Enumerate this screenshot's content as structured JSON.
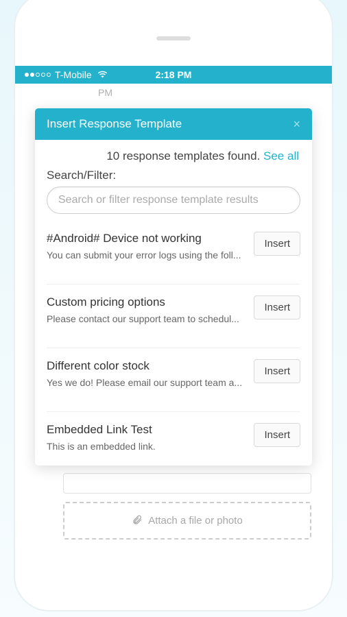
{
  "status_bar": {
    "carrier": "T-Mobile",
    "time": "2:18 PM"
  },
  "background": {
    "pm_text": "PM",
    "attach_label": "Attach a file or photo"
  },
  "modal": {
    "title": "Insert Response Template",
    "close": "×",
    "found_text": "10 response templates found. ",
    "see_all": "See all",
    "filter_label": "Search/Filter:",
    "search_placeholder": "Search or filter response template results",
    "insert_label": "Insert",
    "templates": [
      {
        "title": "#Android# Device not working",
        "desc": "You can submit your error logs using the foll..."
      },
      {
        "title": "Custom pricing options",
        "desc": "Please contact our support team to schedul..."
      },
      {
        "title": "Different color stock",
        "desc": "Yes we do! Please email our support team a..."
      },
      {
        "title": "Embedded Link Test",
        "desc": "This is an embedded link."
      }
    ]
  }
}
